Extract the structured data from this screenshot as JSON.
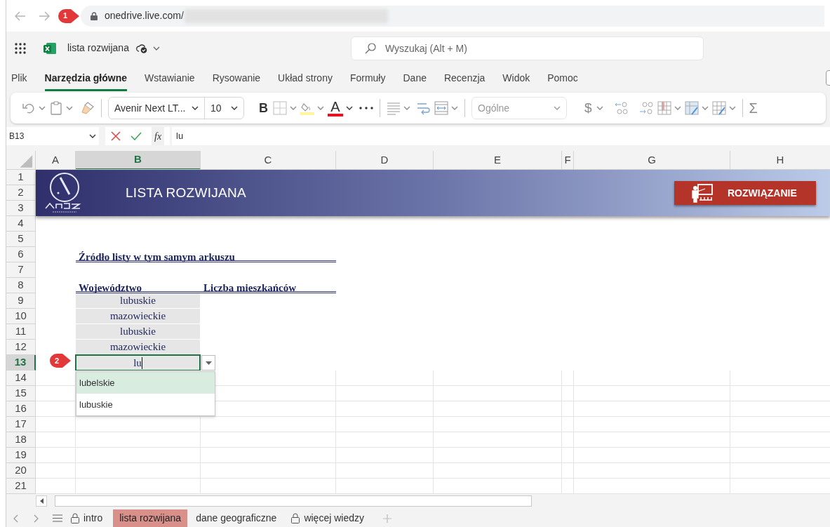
{
  "browser": {
    "address": "onedrive.live.com/",
    "callout": "1"
  },
  "app": {
    "title": "lista rozwijana",
    "search_placeholder": "Wyszukaj (Alt + M)"
  },
  "ribbon_tabs": [
    {
      "label": "Plik",
      "selected": false
    },
    {
      "label": "Narzędzia główne",
      "selected": true
    },
    {
      "label": "Wstawianie",
      "selected": false
    },
    {
      "label": "Rysowanie",
      "selected": false
    },
    {
      "label": "Układ strony",
      "selected": false
    },
    {
      "label": "Formuły",
      "selected": false
    },
    {
      "label": "Dane",
      "selected": false
    },
    {
      "label": "Recenzja",
      "selected": false
    },
    {
      "label": "Widok",
      "selected": false
    },
    {
      "label": "Pomoc",
      "selected": false
    }
  ],
  "toolbar": {
    "font_name": "Avenir Next LT...",
    "font_size": "10",
    "bold": "B",
    "font_color": "A",
    "number_format": "Ogólne",
    "currency": "$",
    "sum": "Σ"
  },
  "formula_bar": {
    "name_box": "B13",
    "fx": "fx",
    "value": "lu"
  },
  "sheet": {
    "columns": [
      {
        "label": "A",
        "selected": false
      },
      {
        "label": "B",
        "selected": true
      },
      {
        "label": "C",
        "selected": false
      },
      {
        "label": "D",
        "selected": false
      },
      {
        "label": "E",
        "selected": false
      },
      {
        "label": "F",
        "selected": false
      },
      {
        "label": "G",
        "selected": false
      },
      {
        "label": "H",
        "selected": false
      }
    ],
    "rows": [
      {
        "label": "1",
        "selected": false
      },
      {
        "label": "2",
        "selected": false
      },
      {
        "label": "3",
        "selected": false
      },
      {
        "label": "4",
        "selected": false
      },
      {
        "label": "5",
        "selected": false
      },
      {
        "label": "6",
        "selected": false
      },
      {
        "label": "7",
        "selected": false
      },
      {
        "label": "8",
        "selected": false
      },
      {
        "label": "9",
        "selected": false
      },
      {
        "label": "10",
        "selected": false
      },
      {
        "label": "11",
        "selected": false
      },
      {
        "label": "12",
        "selected": false
      },
      {
        "label": "13",
        "selected": true
      },
      {
        "label": "14",
        "selected": false
      },
      {
        "label": "15",
        "selected": false
      },
      {
        "label": "16",
        "selected": false
      },
      {
        "label": "17",
        "selected": false
      },
      {
        "label": "18",
        "selected": false
      },
      {
        "label": "19",
        "selected": false
      },
      {
        "label": "20",
        "selected": false
      },
      {
        "label": "21",
        "selected": false
      }
    ],
    "banner": {
      "title": "LISTA ROZWIJANA",
      "button": "ROZWIĄZANIE"
    },
    "heading": "Źródło listy w tym samym arkuszu",
    "table_headers": [
      "Województwo",
      "Liczba mieszkańców"
    ],
    "values": [
      "lubuskie",
      "mazowieckie",
      "lubuskie",
      "mazowieckie"
    ],
    "editing": {
      "value": "lu",
      "callout": "2"
    },
    "suggestions": [
      {
        "label": "lubelskie",
        "selected": true
      },
      {
        "label": "lubuskie",
        "selected": false
      }
    ]
  },
  "sheet_tabs": [
    {
      "label": "intro",
      "selected": false,
      "locked": true
    },
    {
      "label": "lista rozwijana",
      "selected": true,
      "locked": false
    },
    {
      "label": "dane geograficzne",
      "selected": false,
      "locked": false
    },
    {
      "label": "więcej wiedzy",
      "selected": false,
      "locked": true
    }
  ]
}
